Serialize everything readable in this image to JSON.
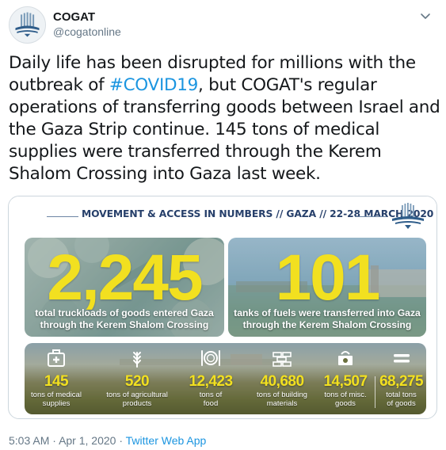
{
  "account": {
    "name": "COGAT",
    "handle": "@cogatonline",
    "avatar_icon": "cogat-emblem-icon"
  },
  "tweet": {
    "text_before_hashtag": "Daily life has been disrupted for millions with the outbreak of ",
    "hashtag": "#COVID19",
    "text_after_hashtag": ", but COGAT's regular operations of transferring goods between Israel and the Gaza Strip continue. 145 tons of medical supplies were transferred through the Kerem Shalom Crossing into Gaza last week."
  },
  "infographic": {
    "title": "MOVEMENT & ACCESS IN NUMBERS // GAZA // 22-28 MARCH 2020",
    "panels": [
      {
        "value": "2,245",
        "caption_line1": "total truckloads of goods entered Gaza",
        "caption_line2": "through the Kerem Shalom Crossing"
      },
      {
        "value": "101",
        "caption_line1": "tanks of fuels were transferred into Gaza",
        "caption_line2": "through the Kerem Shalom Crossing"
      }
    ],
    "stats": [
      {
        "icon": "medical-kit-icon",
        "value": "145",
        "label_line1": "tons of medical",
        "label_line2": "supplies"
      },
      {
        "icon": "wheat-icon",
        "value": "520",
        "label_line1": "tons of agricultural",
        "label_line2": "products"
      },
      {
        "icon": "plate-cutlery-icon",
        "value": "12,423",
        "label_line1": "tons of",
        "label_line2": "food"
      },
      {
        "icon": "bricks-icon",
        "value": "40,680",
        "label_line1": "tons of building",
        "label_line2": "materials"
      },
      {
        "icon": "scale-icon",
        "value": "14,507",
        "label_line1": "tons of misc.",
        "label_line2": "goods"
      },
      {
        "icon": "equals-icon",
        "value": "68,275",
        "label_line1": "total tons",
        "label_line2": "of goods"
      }
    ],
    "colors": {
      "highlight_yellow": "#f2e020",
      "title_navy": "#263f6a"
    }
  },
  "meta": {
    "time": "5:03 AM",
    "separator": "·",
    "date": "Apr 1, 2020",
    "app": "Twitter Web App"
  },
  "colors": {
    "link_blue": "#1b95e0",
    "secondary_gray": "#657786"
  }
}
